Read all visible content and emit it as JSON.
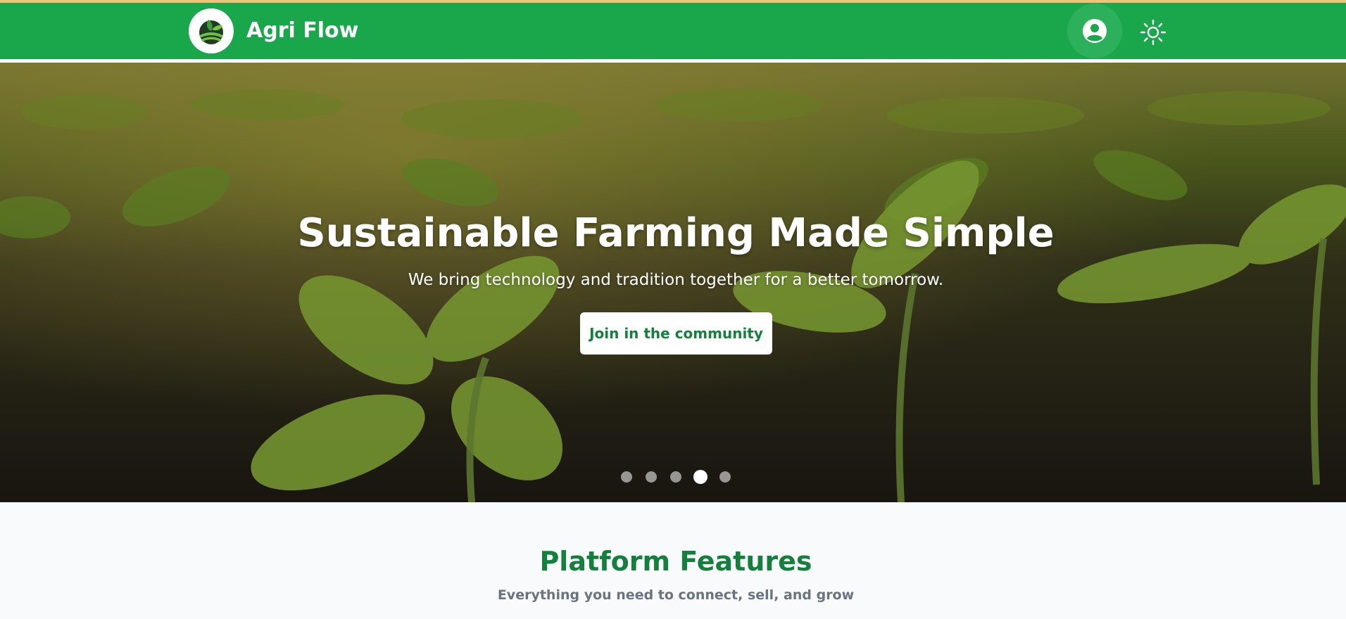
{
  "header": {
    "brand": "Agri Flow",
    "logo_icon": "leaf-field-logo",
    "profile_icon": "user-circle-icon",
    "theme_icon": "sun-icon"
  },
  "hero": {
    "title": "Sustainable Farming Made Simple",
    "subtitle": "We bring technology and tradition together for a better tomorrow.",
    "cta_label": "Join in the community",
    "slides_total": 5,
    "active_slide": 4
  },
  "features": {
    "title": "Platform Features",
    "subtitle": "Everything you need to connect, sell, and grow"
  },
  "colors": {
    "brand_green": "#1aa64b",
    "accent_green": "#15803d",
    "muted_text": "#6b7280"
  }
}
